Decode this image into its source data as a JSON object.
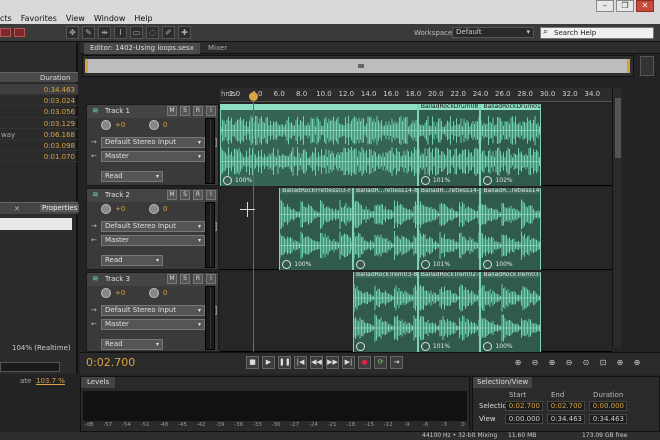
{
  "menu": {
    "items": [
      "cts",
      "Favorites",
      "View",
      "Window",
      "Help"
    ]
  },
  "toolbar": {
    "workspace_label": "Workspace:",
    "workspace_value": "Default",
    "search_placeholder": "Search Help"
  },
  "files_panel": {
    "duration_header": "Duration",
    "rows": [
      {
        "name": "",
        "duration": "0:34.463",
        "selected": true
      },
      {
        "name": "",
        "duration": "0:03.024"
      },
      {
        "name": "",
        "duration": "0:03.056"
      },
      {
        "name": "",
        "duration": "0:03.129"
      },
      {
        "name": "way",
        "duration": "0:06.168"
      },
      {
        "name": "",
        "duration": "0:03.098"
      },
      {
        "name": "",
        "duration": "0:01.070"
      }
    ],
    "tab_label": "Properties",
    "realtime_text": "104% (Realtime)",
    "percent_label": "ate",
    "percent_value": "103.7 %"
  },
  "editor": {
    "tab_label": "Editor: 1402-Using loops.sesx",
    "mixer_label": "Mixer"
  },
  "ruler": {
    "unit_label": "hms",
    "ticks": [
      "2.0",
      "4.0",
      "6.0",
      "8.0",
      "10.0",
      "12.0",
      "14.0",
      "16.0",
      "18.0",
      "20.0",
      "22.0",
      "24.0",
      "26.0",
      "28.0",
      "30.0",
      "32.0",
      "34.0"
    ]
  },
  "tracks": [
    {
      "name": "Track 1",
      "volume": "+0",
      "pan": "0",
      "input": "Default Stereo Input",
      "output": "Master",
      "automation": "Read",
      "clips": [
        {
          "title": "",
          "percent": "100%",
          "start": 0,
          "end": 18.4,
          "selected": true
        },
        {
          "title": "BalladRockDrum08 ...me",
          "percent": "101%",
          "start": 18.4,
          "end": 24.0
        },
        {
          "title": "BalladRockDrum01 ...me",
          "percent": "102%",
          "start": 24.0,
          "end": 29.4
        }
      ]
    },
    {
      "name": "Track 2",
      "volume": "+0",
      "pan": "0",
      "input": "Default Stereo Input",
      "output": "Master",
      "automation": "Read",
      "clips": [
        {
          "title": "BalladRockFretless03-F",
          "percent": "100%",
          "start": 6.0,
          "end": 12.6
        },
        {
          "title": "BalladR...retless14-8minA",
          "percent": "",
          "start": 12.6,
          "end": 18.4
        },
        {
          "title": "BalladR...retless14-8minA",
          "percent": "101%",
          "start": 18.4,
          "end": 24.0
        },
        {
          "title": "BalladR...retless14-8minA",
          "percent": "100%",
          "start": 24.0,
          "end": 29.4
        }
      ]
    },
    {
      "name": "Track 3",
      "volume": "+0",
      "pan": "0",
      "input": "Default Stereo Input",
      "output": "Master",
      "automation": "Read",
      "clips": [
        {
          "title": "BalladRockTrem03-8mi",
          "percent": "",
          "start": 12.6,
          "end": 18.4
        },
        {
          "title": "BalladRockTrem02-Fma7",
          "percent": "101%",
          "start": 18.4,
          "end": 24.0
        },
        {
          "title": "BalladRockTrem03-8mi",
          "percent": "100%",
          "start": 24.0,
          "end": 29.4
        }
      ]
    }
  ],
  "transport": {
    "timecode": "0:02.700"
  },
  "levels": {
    "tab_label": "Levels",
    "scale": [
      "-dB",
      "-57",
      "-54",
      "-51",
      "-48",
      "-45",
      "-42",
      "-39",
      "-36",
      "-33",
      "-30",
      "-27",
      "-24",
      "-21",
      "-18",
      "-15",
      "-12",
      "-9",
      "-6",
      "-3",
      "0"
    ]
  },
  "selection_view": {
    "tab_label": "Selection/View",
    "headers": [
      "Start",
      "End",
      "Duration"
    ],
    "selection": {
      "label": "Selection",
      "start": "0:02.700",
      "end": "0:02.700",
      "duration": "0:00.000"
    },
    "view": {
      "label": "View",
      "start": "0:00.000",
      "end": "0:34.463",
      "duration": "0:34.463"
    }
  },
  "status": {
    "format": "44100 Hz • 32-bit Mixing",
    "size": "11.60 MB",
    "free": "173.09 GB free"
  },
  "colors": {
    "accent": "#d9a441",
    "clip": "#2f5a4d",
    "wave": "#6fd1b0",
    "playhead": "#c94040"
  }
}
